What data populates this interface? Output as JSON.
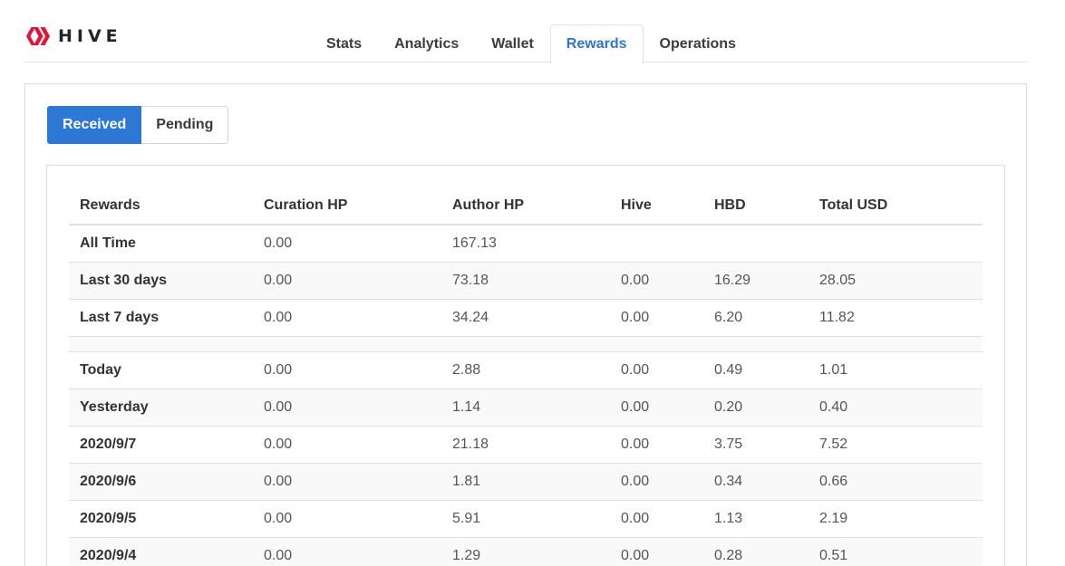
{
  "brand": {
    "name": "HIVE",
    "logo_icon": "hive-logo-icon",
    "color": "#e31337"
  },
  "nav": {
    "tabs": [
      {
        "label": "Stats",
        "active": false
      },
      {
        "label": "Analytics",
        "active": false
      },
      {
        "label": "Wallet",
        "active": false
      },
      {
        "label": "Rewards",
        "active": true
      },
      {
        "label": "Operations",
        "active": false
      }
    ]
  },
  "toggle": {
    "received": "Received",
    "pending": "Pending",
    "active": "Received"
  },
  "table": {
    "headers": [
      "Rewards",
      "Curation HP",
      "Author HP",
      "Hive",
      "HBD",
      "Total USD"
    ],
    "summary_rows": [
      [
        "All Time",
        "0.00",
        "167.13",
        "",
        "",
        ""
      ],
      [
        "Last 30 days",
        "0.00",
        "73.18",
        "0.00",
        "16.29",
        "28.05"
      ],
      [
        "Last 7 days",
        "0.00",
        "34.24",
        "0.00",
        "6.20",
        "11.82"
      ]
    ],
    "daily_rows": [
      [
        "Today",
        "0.00",
        "2.88",
        "0.00",
        "0.49",
        "1.01"
      ],
      [
        "Yesterday",
        "0.00",
        "1.14",
        "0.00",
        "0.20",
        "0.40"
      ],
      [
        "2020/9/7",
        "0.00",
        "21.18",
        "0.00",
        "3.75",
        "7.52"
      ],
      [
        "2020/9/6",
        "0.00",
        "1.81",
        "0.00",
        "0.34",
        "0.66"
      ],
      [
        "2020/9/5",
        "0.00",
        "5.91",
        "0.00",
        "1.13",
        "2.19"
      ],
      [
        "2020/9/4",
        "0.00",
        "1.29",
        "0.00",
        "0.28",
        "0.51"
      ]
    ]
  },
  "colors": {
    "accent": "#2c78d4",
    "active_tab_text": "#2f76c6"
  }
}
